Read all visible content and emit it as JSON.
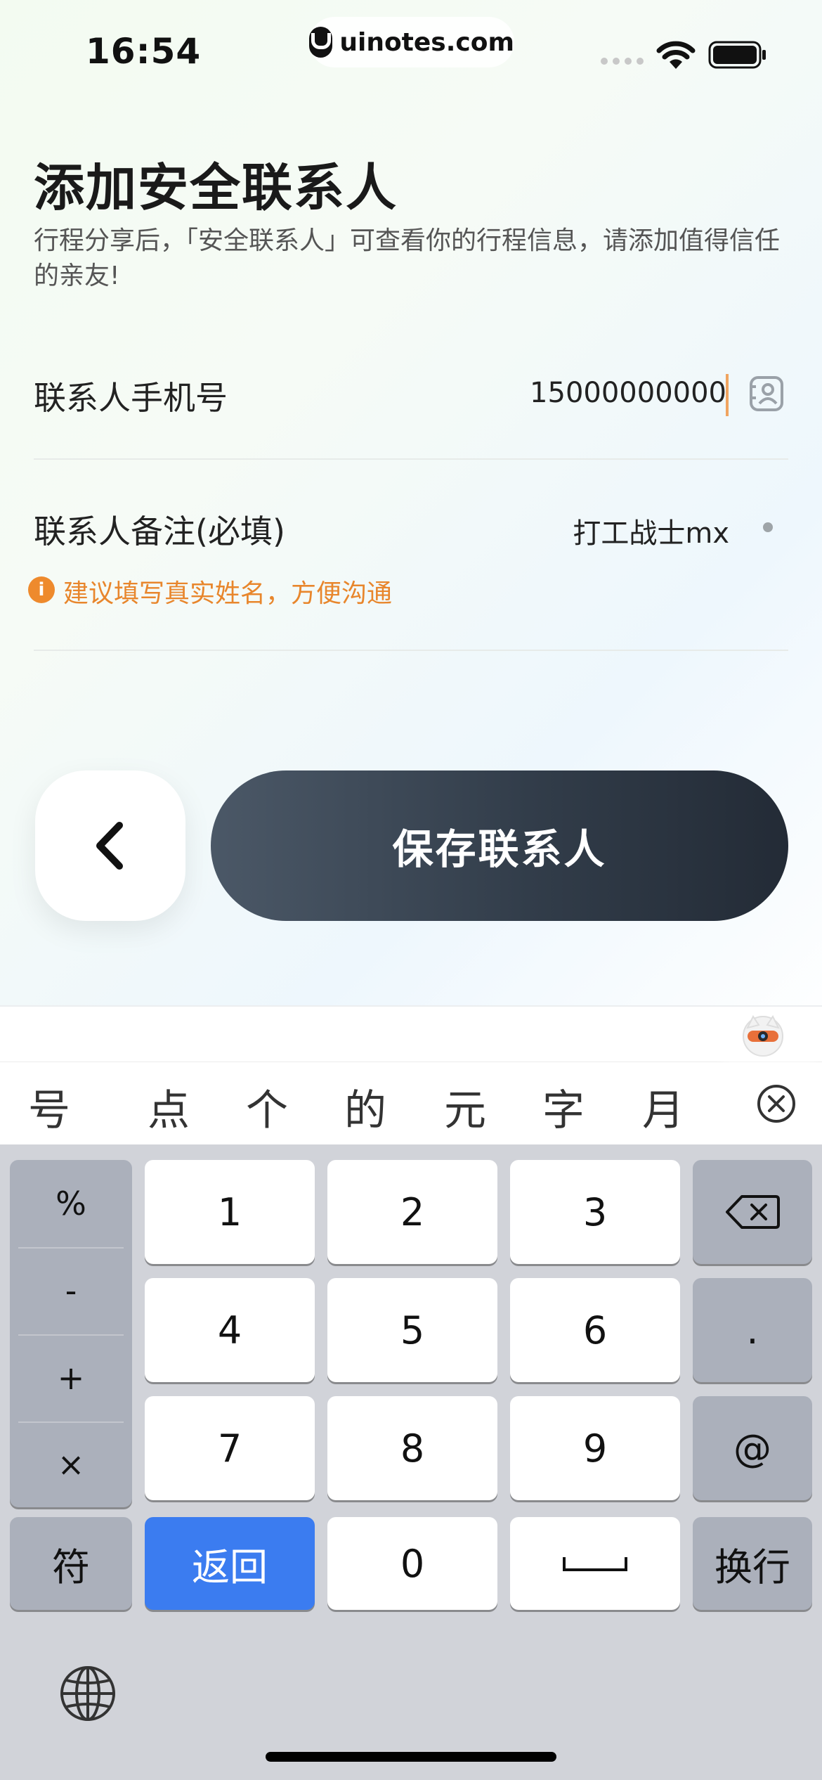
{
  "status_bar": {
    "time": "16:54",
    "site_label": "uinotes.com"
  },
  "page": {
    "title": "添加安全联系人",
    "subtitle": "行程分享后，「安全联系人」可查看你的行程信息，请添加值得信任的亲友!"
  },
  "form": {
    "phone": {
      "label": "联系人手机号",
      "value": "15000000000"
    },
    "remark": {
      "label": "联系人备注(必填)",
      "value": "打工战士mx"
    },
    "tip": "建议填写真实姓名，方便沟通"
  },
  "actions": {
    "save_label": "保存联系人"
  },
  "keyboard": {
    "candidates": [
      "号",
      "点",
      "个",
      "的",
      "元",
      "字",
      "月"
    ],
    "symbols": [
      "%",
      "-",
      "+",
      "×"
    ],
    "digits": [
      "1",
      "2",
      "3",
      "4",
      "5",
      "6",
      "7",
      "8",
      "9",
      "0"
    ],
    "dot_key": ".",
    "at_key": "@",
    "symbol_key": "符",
    "return_key": "返回",
    "newline_key": "换行"
  },
  "colors": {
    "accent_orange": "#ee8a2d",
    "return_key_blue": "#3b7cf0",
    "save_button_dark": "#2a333f"
  }
}
